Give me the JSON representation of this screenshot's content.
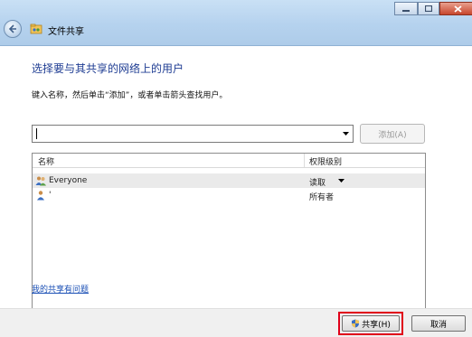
{
  "window": {
    "title": "文件共享"
  },
  "main": {
    "heading": "选择要与其共享的网络上的用户",
    "instruction": "键入名称，然后单击“添加”，或者单击箭头查找用户。",
    "name_input": {
      "value": ""
    },
    "add_button": "添加(A)"
  },
  "list": {
    "columns": {
      "name": "名称",
      "permission": "权限级别"
    },
    "rows": [
      {
        "name": "Everyone",
        "permission": "读取",
        "selected": true
      },
      {
        "name": "'",
        "permission": "所有者",
        "selected": false
      }
    ]
  },
  "help_link": "我的共享有问题",
  "footer": {
    "share_button": "共享(H)",
    "cancel_button": "取消"
  },
  "colors": {
    "heading": "#1f3d93",
    "link": "#1a4fb5",
    "highlight_border": "#e0001a"
  }
}
